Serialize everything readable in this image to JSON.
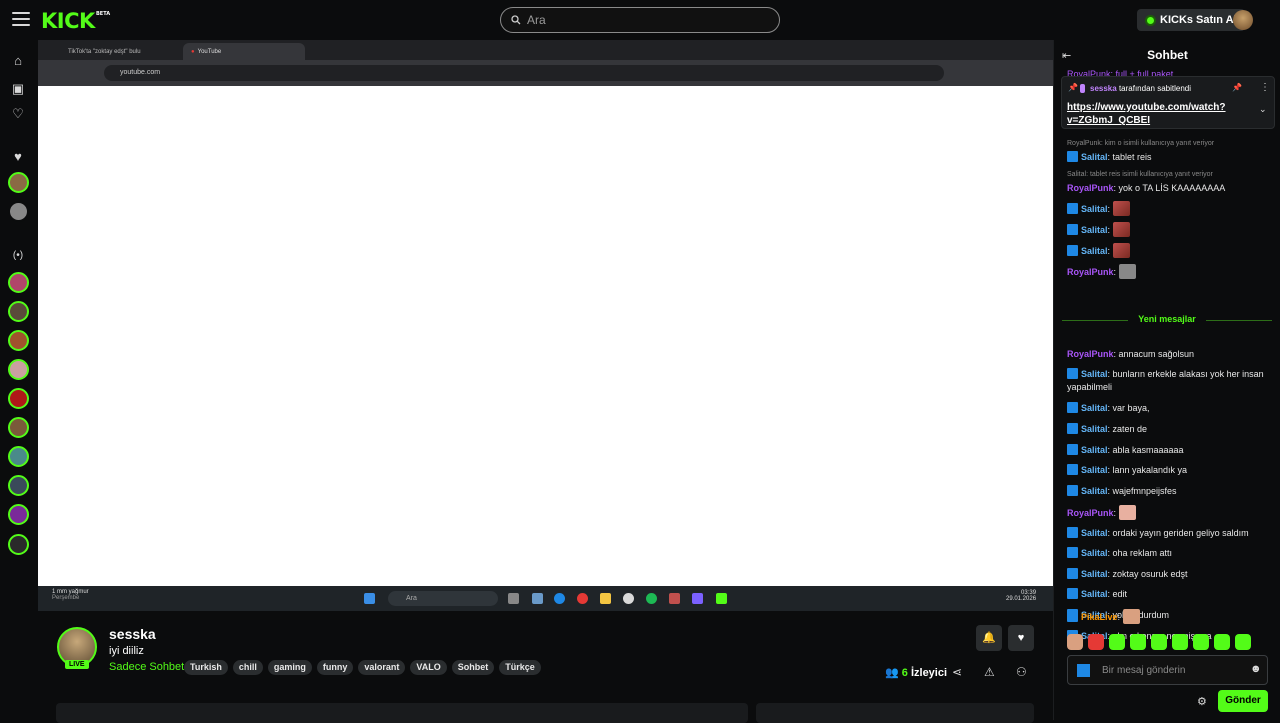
{
  "topbar": {
    "logo": "KICK",
    "logo_badge": "BETA",
    "search_placeholder": "Ara",
    "kicks_button": "KICKs Satın Al"
  },
  "video": {
    "tabs": [
      "TikTok'ta \"zoktay edşt\" bulu",
      "YouTube"
    ],
    "address": "youtube.com",
    "taskbar_search": "Ara",
    "weather_line1": "1 mm yağmur",
    "weather_line2": "Perşembe",
    "clock_time": "03:39",
    "clock_date": "29.01.2026"
  },
  "stream": {
    "streamer": "sesska",
    "title": "iyi diiliz",
    "category": "Sadece Sohbet",
    "live_label": "LIVE",
    "tags": [
      "Turkish",
      "chill",
      "gaming",
      "funny",
      "valorant",
      "VALO",
      "Sohbet",
      "Türkçe"
    ],
    "viewer_count": "6",
    "viewer_label": "İzleyici"
  },
  "chat": {
    "title": "Sohbet",
    "pinned_by_user": "sesska",
    "pinned_by_text": "tarafından sabitlendi",
    "pinned_link": "https://www.youtube.com/watch?v=ZGbmJ_QCBEI",
    "top_partial": "RoyalPunk: full + full paket",
    "reply1": "RoyalPunk: kim o isimli kullanıcıya yanıt veriyor",
    "msg1_user": "Salital",
    "msg1_text": ": tablet reis",
    "reply2": "Salital: tablet reis isimli kullanıcıya yanıt veriyor",
    "msg2_user": "RoyalPunk",
    "msg2_text": ": yok o TA LİS KAAAAAAAA",
    "msg3_user": "Salital",
    "msg4_user": "Salital",
    "msg5_user": "Salital",
    "msg6_user": "RoyalPunk",
    "new_messages": "Yeni mesajlar",
    "msg7_user": "RoyalPunk",
    "msg7_text": ": annacum sağolsun",
    "msg8_user": "Salital",
    "msg8_text": ": bunların erkekle alakası yok her insan yapabilmeli",
    "msg9_user": "Salital",
    "msg9_text": ": var baya,",
    "msg10_user": "Salital",
    "msg10_text": ": zaten de",
    "msg11_user": "Salital",
    "msg11_text": ": abla kasmaaaaaa",
    "msg12_user": "Salital",
    "msg12_text": ": lann yakalandık ya",
    "msg13_user": "Salital",
    "msg13_text": ": wajefmnpeijsfes",
    "msg14_user": "RoyalPunk",
    "msg15_user": "Salital",
    "msg15_text": ": ordaki yayın geriden geliyo saldım",
    "msg16_user": "Salital",
    "msg16_text": ": oha reklam attı",
    "msg17_user": "Salital",
    "msg17_text": ": zoktay osuruk edşt",
    "msg18_user": "Salital",
    "msg18_text": ": edit",
    "msg19_user": "Salital",
    "msg19_text": ": yok uydurdum",
    "msg20_user": "Salital",
    "msg20_text": ": olm o konser neymişş ya",
    "msg21_user": "PikaLive",
    "input_placeholder": "Bir mesaj gönderin",
    "send_label": "Gönder"
  },
  "colors": {
    "accent": "#53fc18",
    "background": "#0b0c0d"
  }
}
